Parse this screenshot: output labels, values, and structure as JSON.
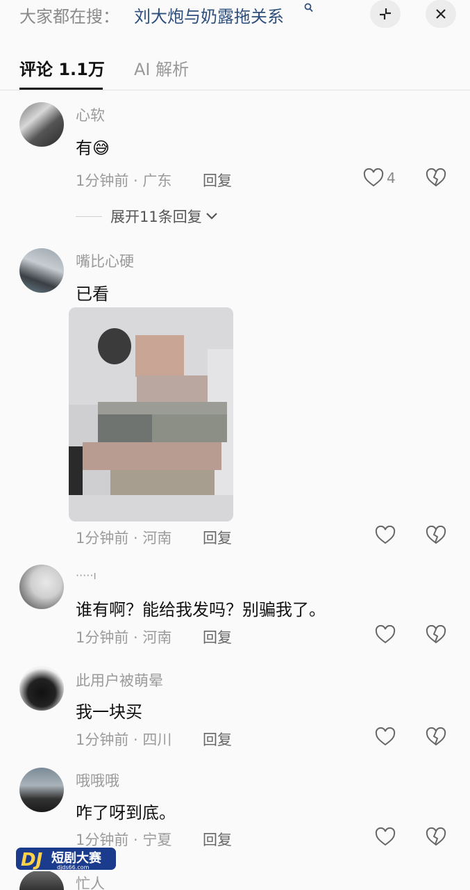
{
  "search": {
    "prefix": "大家都在搜：",
    "query": "刘大炮与奶露拖关系",
    "icon": "search-icon"
  },
  "tabs": [
    {
      "label": "评论 1.1万",
      "active": true
    },
    {
      "label": "AI 解析",
      "active": false
    }
  ],
  "comments": [
    {
      "username": "心软",
      "text": "有",
      "emoji": "😅",
      "time": "1分钟前",
      "location": "广东",
      "meta": "1分钟前 · 广东",
      "reply": "回复",
      "likes": "4",
      "expand": "展开11条回复"
    },
    {
      "username": "嘴比心硬",
      "text": "已看",
      "has_image": true,
      "meta": "1分钟前 · 河南",
      "reply": "回复"
    },
    {
      "username": "·····ı",
      "text": "谁有啊？能给我发吗？别骗我了。",
      "meta": "1分钟前 · 河南",
      "reply": "回复"
    },
    {
      "username": "此用户被萌晕",
      "text": "我一块买",
      "meta": "1分钟前 · 四川",
      "reply": "回复"
    },
    {
      "username": "哦哦哦",
      "text": "咋了呀到底。",
      "meta": "1分钟前 · 宁夏",
      "reply": "回复"
    },
    {
      "username": "忙人"
    }
  ],
  "watermark": {
    "brand": "DJ",
    "title": "短剧大赛",
    "url": "djds66.com"
  },
  "colors": {
    "background": "#fafafa",
    "search_link": "#2e4f7c",
    "meta_gray": "#9b9b9b"
  }
}
